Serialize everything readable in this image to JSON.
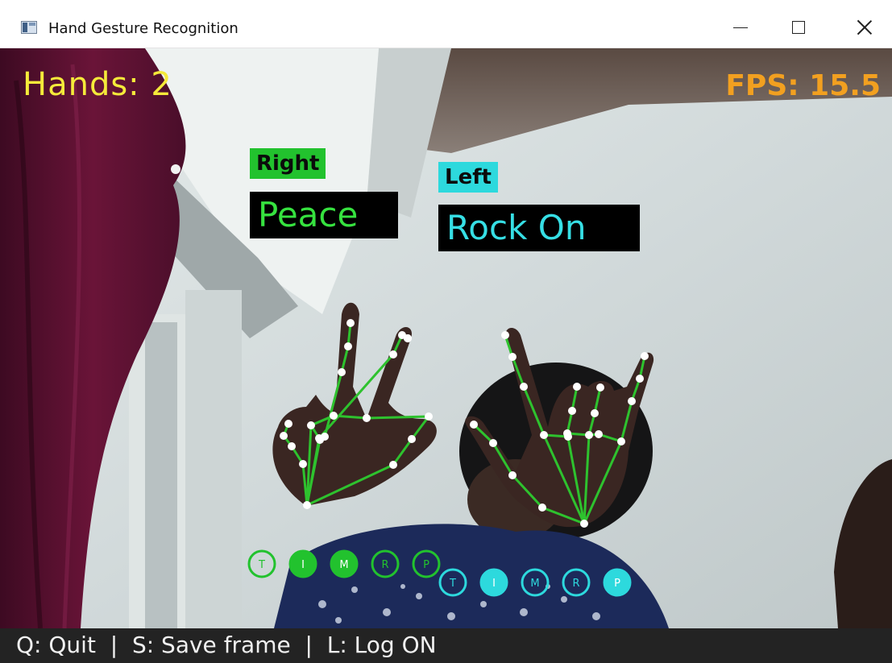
{
  "window": {
    "title": "Hand Gesture Recognition"
  },
  "overlay": {
    "hands_count": "Hands: 2",
    "fps": "FPS: 15.5",
    "colors": {
      "hands_text": "#f5ea3a",
      "fps_text": "#f2a020",
      "right_accent": "#22c22e",
      "left_accent": "#2dd9dd",
      "skeleton": "#2ec22e",
      "landmark": "#ffffff"
    }
  },
  "hands": [
    {
      "side": "Right",
      "gesture": "Peace",
      "fingers": [
        {
          "letter": "T",
          "extended": false
        },
        {
          "letter": "I",
          "extended": true
        },
        {
          "letter": "M",
          "extended": true
        },
        {
          "letter": "R",
          "extended": false
        },
        {
          "letter": "P",
          "extended": false
        }
      ]
    },
    {
      "side": "Left",
      "gesture": "Rock On",
      "fingers": [
        {
          "letter": "T",
          "extended": false
        },
        {
          "letter": "I",
          "extended": true
        },
        {
          "letter": "M",
          "extended": false
        },
        {
          "letter": "R",
          "extended": false
        },
        {
          "letter": "P",
          "extended": true
        }
      ]
    }
  ],
  "statusbar": {
    "text": "Q: Quit  |  S: Save frame  |  L: Log ON"
  }
}
